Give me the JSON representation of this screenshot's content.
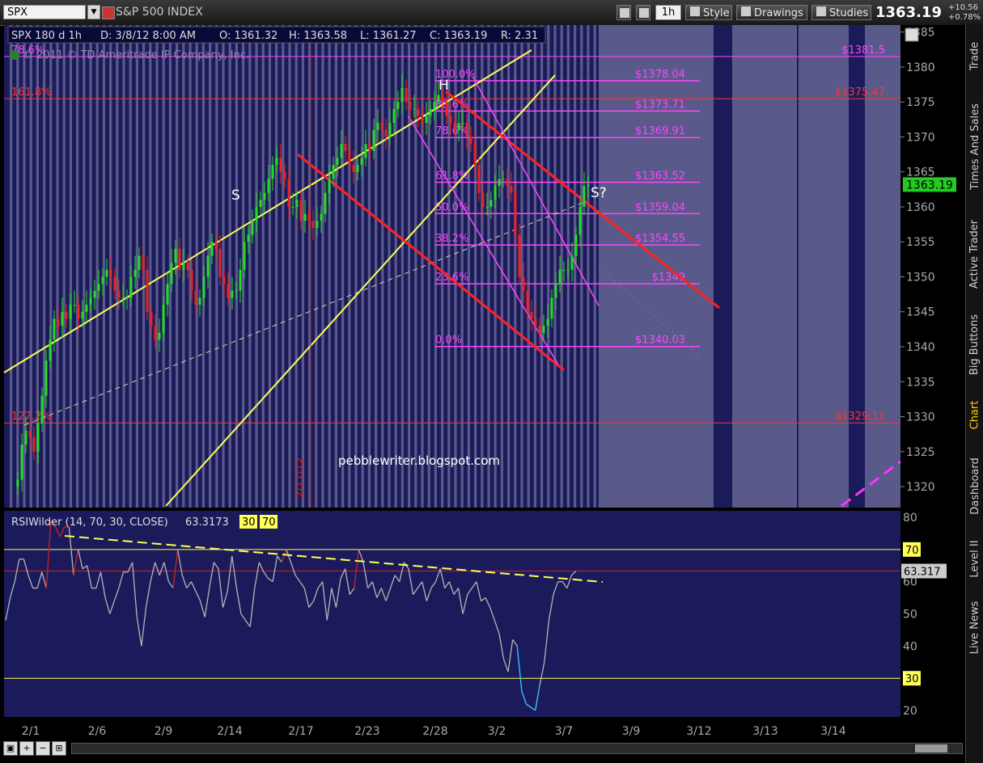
{
  "toolbar": {
    "symbol": "SPX",
    "index_name": "S&P 500 INDEX",
    "timeframe": "1h",
    "style_label": "Style",
    "drawings_label": "Drawings",
    "studies_label": "Studies",
    "last_price": "1363.19",
    "change_abs": "+10.56",
    "change_pct": "+0.78%"
  },
  "sidebar": {
    "tabs": [
      "Trade",
      "Times And Sales",
      "Active Trader",
      "Big Buttons",
      "Chart",
      "Dashboard",
      "Level II",
      "Live News"
    ],
    "active": "Chart"
  },
  "header": {
    "label": "SPX 180 d 1h",
    "date": "D: 3/8/12 8:00 AM",
    "open": "O: 1361.32",
    "high": "H: 1363.58",
    "low": "L: 1361.27",
    "close": "C: 1363.19",
    "range": "R: 2.31",
    "copyright": "© 2011 © TD Ameritrade IP Company, Inc."
  },
  "colors": {
    "background": "#1b1b5c",
    "price_line": "#ffff55",
    "fib": "#ff44ff",
    "red_channel": "#ff2222",
    "rsi": "#b4b4b4"
  },
  "chart_data": [
    {
      "type": "candlestick",
      "ylim": [
        1317,
        1386
      ],
      "y_ticks": [
        1320,
        1325,
        1330,
        1335,
        1340,
        1345,
        1350,
        1355,
        1360,
        1365,
        1370,
        1375,
        1380,
        1385
      ],
      "x_ticks": [
        "2/1",
        "2/6",
        "2/9",
        "2/14",
        "2/17",
        "2/23",
        "2/28",
        "3/2",
        "3/7",
        "3/9",
        "3/12",
        "3/13",
        "3/14"
      ],
      "vertical_date_label": "2/17/12",
      "last_price_label": "1363.19",
      "watermark": "pebblewriter.blogspot.com",
      "pattern_labels": [
        "S",
        "H",
        "S?"
      ],
      "fib_retracement": [
        {
          "pct": "100.0%",
          "price": "$1378.04",
          "level": 1378.04
        },
        {
          "pct": "88.6%",
          "price": "$1373.71",
          "level": 1373.71
        },
        {
          "pct": "78.6%",
          "price": "$1369.91",
          "level": 1369.91
        },
        {
          "pct": "61.8%",
          "price": "$1363.52",
          "level": 1363.52
        },
        {
          "pct": "50.0%",
          "price": "$1359.04",
          "level": 1359.04
        },
        {
          "pct": "38.2%",
          "price": "$1354.55",
          "level": 1354.55
        },
        {
          "pct": "23.6%",
          "price": "$1349",
          "level": 1349
        },
        {
          "pct": "0.0%",
          "price": "$1340.03",
          "level": 1340.03
        }
      ],
      "fib_extensions": [
        {
          "pct": "78.6%",
          "price": "$1381.5",
          "level": 1381.5
        },
        {
          "pct": "161.8%",
          "price": "$1375.47",
          "level": 1375.47
        },
        {
          "pct": "127.2%",
          "price": "$1329.11",
          "level": 1329.11
        }
      ],
      "series": [
        {
          "name": "SPX",
          "close": [
            1321,
            1326,
            1328,
            1327,
            1325,
            1329,
            1333,
            1338,
            1341,
            1344,
            1343,
            1345,
            1344,
            1346,
            1346,
            1344,
            1345,
            1346,
            1347,
            1348,
            1349,
            1350,
            1351,
            1350,
            1348,
            1347,
            1347,
            1347,
            1350,
            1351,
            1353,
            1351,
            1345,
            1343,
            1341,
            1342,
            1346,
            1349,
            1352,
            1354,
            1351,
            1352,
            1351,
            1348,
            1346,
            1347,
            1350,
            1353,
            1355,
            1354,
            1350,
            1349,
            1347,
            1348,
            1348,
            1351,
            1355,
            1356,
            1358,
            1360,
            1361,
            1362,
            1364,
            1366,
            1367,
            1365,
            1364,
            1360,
            1360,
            1361,
            1358,
            1359,
            1358,
            1357,
            1358,
            1359,
            1362,
            1364,
            1366,
            1367,
            1369,
            1368,
            1366,
            1365,
            1366,
            1367,
            1369,
            1368,
            1371,
            1372,
            1371,
            1370,
            1372,
            1374,
            1375,
            1377,
            1375,
            1374,
            1374,
            1373,
            1372,
            1373,
            1374,
            1375,
            1376,
            1375,
            1373,
            1372,
            1371,
            1372,
            1372,
            1370,
            1369,
            1366,
            1362,
            1360,
            1360,
            1361,
            1363,
            1364,
            1364,
            1363,
            1362,
            1356,
            1350,
            1348,
            1345,
            1344,
            1343,
            1342,
            1343,
            1344,
            1347,
            1349,
            1351,
            1351,
            1351,
            1353,
            1356,
            1360,
            1363,
            1363.19
          ]
        }
      ],
      "trendlines": [
        {
          "color": "yellow",
          "desc": "upper rising wedge line"
        },
        {
          "color": "yellow",
          "desc": "steep rising line"
        },
        {
          "color": "yellow",
          "desc": "dashed neckline"
        },
        {
          "color": "red",
          "desc": "descending channel upper"
        },
        {
          "color": "red",
          "desc": "descending channel lower"
        },
        {
          "color": "magenta",
          "desc": "descending channel"
        }
      ]
    },
    {
      "type": "line",
      "title": "RSIWilder (14, 70, 30, CLOSE)",
      "last_value_label": "63.3173",
      "last_value_tag": "63.317",
      "ylim": [
        18,
        82
      ],
      "y_ticks": [
        20,
        30,
        40,
        50,
        60,
        70,
        80
      ],
      "levels": [
        30,
        70
      ],
      "level_labels": [
        "30",
        "70"
      ],
      "series": [
        {
          "name": "RSI",
          "values": [
            48,
            55,
            60,
            67,
            67,
            62,
            58,
            58,
            63,
            58,
            79,
            77,
            74,
            77,
            77,
            62,
            70,
            64,
            65,
            58,
            58,
            63,
            55,
            50,
            54,
            58,
            63,
            63,
            66,
            49,
            40,
            52,
            60,
            66,
            62,
            66,
            60,
            58,
            70,
            62,
            58,
            60,
            57,
            54,
            49,
            58,
            66,
            64,
            52,
            57,
            68,
            58,
            50,
            48,
            46,
            58,
            66,
            63,
            61,
            60,
            68,
            66,
            70,
            66,
            62,
            60,
            58,
            52,
            54,
            58,
            60,
            48,
            58,
            52,
            61,
            64,
            56,
            58,
            70,
            66,
            58,
            60,
            55,
            58,
            54,
            58,
            62,
            60,
            66,
            64,
            56,
            58,
            60,
            54,
            58,
            60,
            64,
            58,
            60,
            56,
            58,
            50,
            56,
            58,
            60,
            54,
            55,
            52,
            48,
            44,
            36,
            32,
            42,
            40,
            26,
            22,
            21,
            20,
            28,
            35,
            48,
            56,
            60,
            60,
            58,
            62,
            63.3
          ]
        }
      ]
    }
  ]
}
